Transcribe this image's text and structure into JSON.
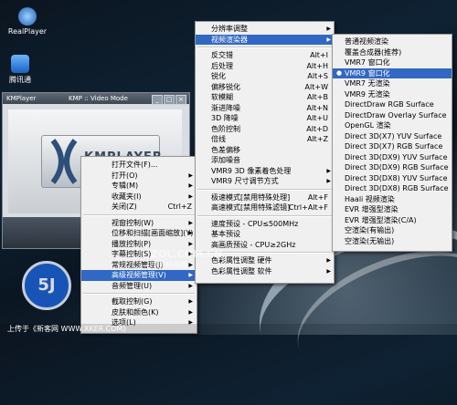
{
  "desktop": {
    "icons": [
      {
        "label": "RealPlayer",
        "icon": "realplayer-icon"
      },
      {
        "label": "腾讯通",
        "icon": "tencent-icon"
      }
    ]
  },
  "kmplayer": {
    "title": "KMPlayer",
    "mode": "KMP :: Video Mode",
    "logo_text": "KMPLAYER",
    "window_buttons": [
      "_",
      "□",
      "×"
    ]
  },
  "main_menu": {
    "items": [
      {
        "label": "打开文件(F)...",
        "submenu": false
      },
      {
        "label": "打开(O)",
        "submenu": true
      },
      {
        "label": "专辑(M)",
        "submenu": true
      },
      {
        "label": "收藏夹(I)",
        "submenu": true
      },
      {
        "label": "关闭(Z)",
        "shortcut": "Ctrl+Z"
      },
      {
        "sep": true
      },
      {
        "label": "视窗控制(W)",
        "submenu": true
      },
      {
        "label": "位移和扫描[画面缩放](Y)",
        "submenu": true
      },
      {
        "label": "播放控制(P)",
        "submenu": true
      },
      {
        "label": "字幕控制(S)",
        "submenu": true
      },
      {
        "label": "常规视频管理(J)",
        "submenu": true
      },
      {
        "label": "高级视频管理(V)",
        "submenu": true,
        "highlight": true
      },
      {
        "label": "音频管理(U)",
        "submenu": true
      },
      {
        "sep": true
      },
      {
        "label": "截取控制(G)",
        "submenu": true
      },
      {
        "label": "皮肤和颜色(K)",
        "submenu": true
      },
      {
        "label": "选项(L)",
        "submenu": true
      }
    ]
  },
  "video_menu": {
    "items": [
      {
        "label": "分辨率调整",
        "submenu": true
      },
      {
        "label": "视频渲染器",
        "submenu": true,
        "highlight": true
      },
      {
        "sep": true
      },
      {
        "label": "反交错",
        "shortcut": "Alt+I"
      },
      {
        "label": "后处理",
        "shortcut": "Alt+H"
      },
      {
        "label": "锐化",
        "shortcut": "Alt+S"
      },
      {
        "label": "偏移锐化",
        "shortcut": "Alt+W"
      },
      {
        "label": "软模糊",
        "shortcut": "Alt+B"
      },
      {
        "label": "渐进降噪",
        "shortcut": "Alt+N"
      },
      {
        "label": "3D 降噪",
        "shortcut": "Alt+U"
      },
      {
        "label": "色阶控制",
        "shortcut": "Alt+D"
      },
      {
        "label": "倍线",
        "shortcut": "Alt+Z"
      },
      {
        "label": "色差偏移"
      },
      {
        "label": "添加噪音"
      },
      {
        "label": "VMR9 3D 像素着色处理",
        "submenu": true
      },
      {
        "label": "VMR9 尺寸调节方式",
        "submenu": true
      },
      {
        "sep": true
      },
      {
        "label": "极速模式[禁用特殊处理]",
        "shortcut": "Alt+F"
      },
      {
        "label": "高速模式[禁用特殊滤镜]",
        "shortcut": "Ctrl+Alt+F"
      },
      {
        "sep": true
      },
      {
        "label": "速度预设 - CPU≤500MHz"
      },
      {
        "label": "基本预设"
      },
      {
        "label": "高画质预设 - CPU≥2GHz"
      },
      {
        "sep": true
      },
      {
        "label": "色彩属性调整 硬件",
        "submenu": true
      },
      {
        "label": "色彩属性调整 软件",
        "submenu": true
      }
    ]
  },
  "renderer_menu": {
    "items": [
      {
        "label": "普通视频渲染"
      },
      {
        "label": "覆盖合成器(推荐)"
      },
      {
        "label": "VMR7 窗口化"
      },
      {
        "label": "VMR9 窗口化",
        "highlight": true,
        "checked": true
      },
      {
        "label": "VMR7 无渲染"
      },
      {
        "label": "VMR9 无渲染"
      },
      {
        "label": "DirectDraw RGB Surface"
      },
      {
        "label": "DirectDraw Overlay Surface"
      },
      {
        "label": "OpenGL 渲染"
      },
      {
        "label": "Direct 3D(X7) YUV Surface"
      },
      {
        "label": "Direct 3D(X7) RGB Surface"
      },
      {
        "label": "Direct 3D(DX9) YUV Surface"
      },
      {
        "label": "Direct 3D(DX9) RGB Surface"
      },
      {
        "label": "Direct 3D(DX8) YUV Surface"
      },
      {
        "label": "Direct 3D(DX8) RGB Surface"
      },
      {
        "label": "Haali 视频渲染"
      },
      {
        "label": "EVR 增强型渲染"
      },
      {
        "label": "EVR 增强型渲染(C/A)"
      },
      {
        "label": "空渲染(有输出)"
      },
      {
        "label": "空渲染(无输出)"
      }
    ]
  },
  "watermarks": {
    "zol": "ZOL.COM.CN",
    "zol_sub": "中关村在线",
    "badge": "5J",
    "bottom_text": "上传于《新客网 WWW.XKER.COM》"
  },
  "colors": {
    "highlight": "#3168c4",
    "menu_bg": "#f0f0f0",
    "badge": "#1b5fd0"
  }
}
